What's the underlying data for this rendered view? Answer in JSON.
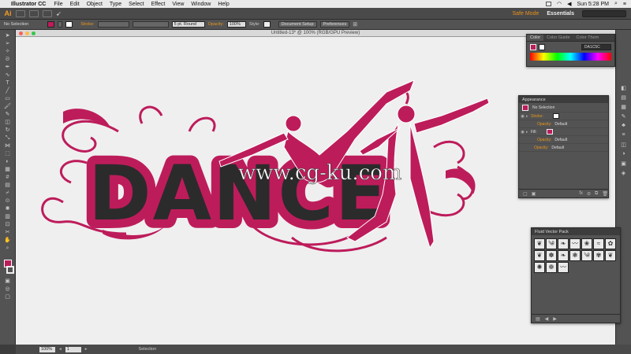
{
  "menubar": {
    "apple": "",
    "app_name": "Illustrator CC",
    "items": [
      "File",
      "Edit",
      "Object",
      "Type",
      "Select",
      "Effect",
      "View",
      "Window",
      "Help"
    ],
    "clock": "Sun 5:28 PM"
  },
  "appbar": {
    "logo": "Ai",
    "safe_mode": "Safe Mode",
    "workspace": "Essentials"
  },
  "control": {
    "selection_label": "No Selection",
    "stroke_label": "Stroke:",
    "brush": "5 pt. Round",
    "opacity_label": "Opacity:",
    "opacity_value": "100%",
    "style_label": "Style:",
    "doc_setup": "Document Setup",
    "preferences": "Preferences"
  },
  "document": {
    "tab_title": "Untitled-13* @ 100% (RGB/GPU Preview)"
  },
  "artwork": {
    "main_text": "DANCE",
    "watermark": "www.cg-ku.com",
    "text_color": "#2b2b2b",
    "accent_color": "#bd1c5b"
  },
  "color_panel": {
    "tabs": [
      "Color",
      "Color Guide",
      "Color Them"
    ],
    "hex": "DA1C5C"
  },
  "appearance_panel": {
    "title": "Appearance",
    "selection": "No Selection",
    "rows": [
      {
        "label": "Stroke:",
        "value": ""
      },
      {
        "label": "Opacity:",
        "value": "Default"
      },
      {
        "label": "Fill:",
        "value": ""
      },
      {
        "label": "Opacity:",
        "value": "Default"
      },
      {
        "label": "Opacity:",
        "value": "Default"
      }
    ]
  },
  "vector_panel": {
    "title": "Fluid Vector Pack",
    "items": [
      "",
      "",
      "",
      "",
      "",
      "",
      "",
      "",
      "",
      "",
      "",
      "",
      "",
      "",
      "",
      "",
      ""
    ]
  },
  "status": {
    "zoom": "100%",
    "artboard": "1",
    "mode": "Selection"
  }
}
